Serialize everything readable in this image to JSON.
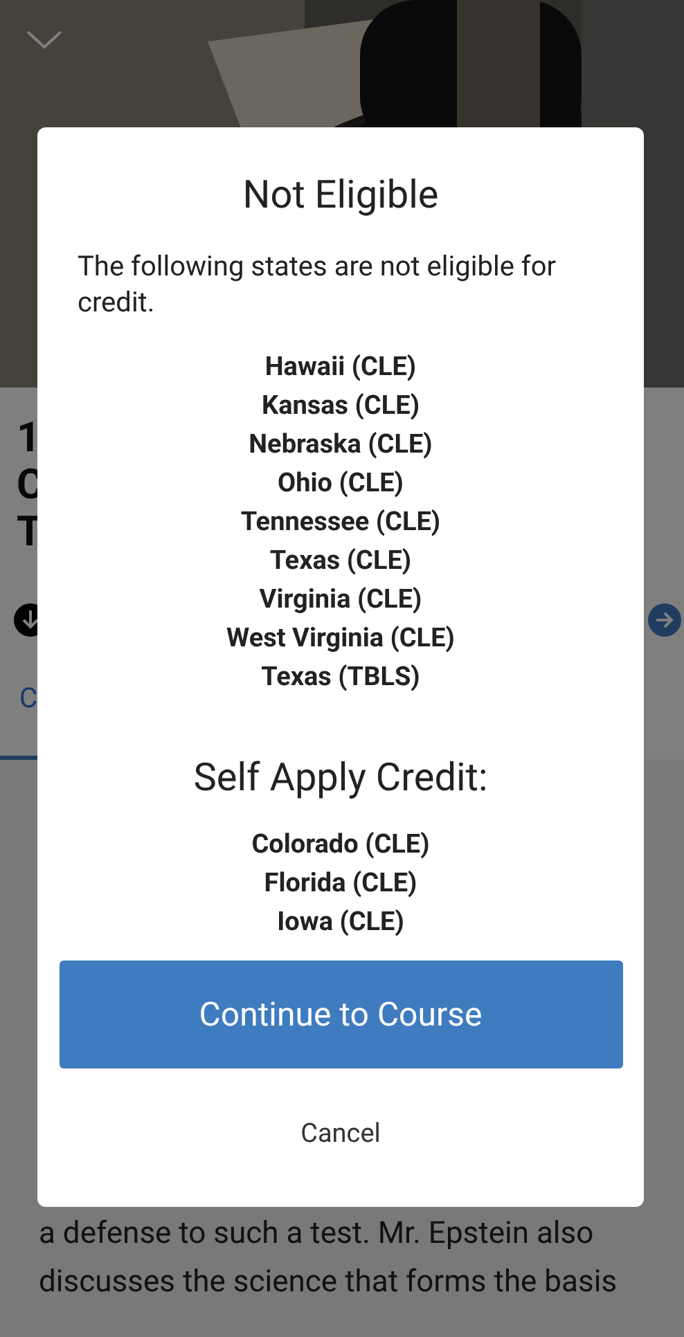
{
  "background": {
    "title_lines": [
      "1",
      "C",
      "T"
    ],
    "tab": {
      "label": "C",
      "selected": true
    },
    "body_lines": [
      "a defense to such a test. Mr. Epstein also",
      "discusses the science that forms the basis"
    ]
  },
  "dialog": {
    "title": "Not Eligible",
    "message": "The following states are not eligible for credit.",
    "not_eligible": [
      "Hawaii (CLE)",
      "Kansas (CLE)",
      "Nebraska (CLE)",
      "Ohio (CLE)",
      "Tennessee (CLE)",
      "Texas (CLE)",
      "Virginia (CLE)",
      "West Virginia (CLE)",
      "Texas (TBLS)"
    ],
    "self_apply_title": "Self Apply Credit:",
    "self_apply": [
      "Colorado (CLE)",
      "Florida (CLE)",
      "Iowa (CLE)"
    ],
    "primary_button": "Continue to Course",
    "cancel_button": "Cancel"
  }
}
